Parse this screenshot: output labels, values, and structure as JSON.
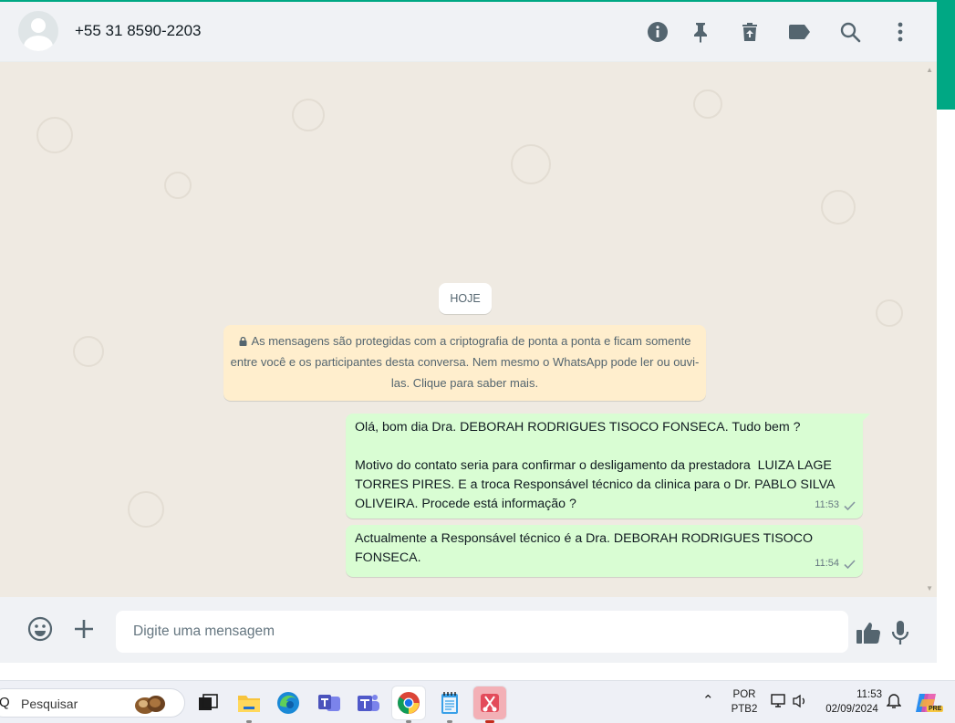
{
  "window": {
    "accent_color": "#00a884",
    "chat_bg": "#efeae2",
    "outgoing_bubble_color": "#d9fdd3"
  },
  "header": {
    "contact_name": "+55 31 8590-2203",
    "icons": [
      "info-icon",
      "pin-icon",
      "delete-icon",
      "label-icon",
      "search-icon",
      "menu-icon"
    ]
  },
  "chat": {
    "date_chip": "HOJE",
    "encryption_notice": "As mensagens são protegidas com a criptografia de ponta a ponta e ficam somente entre você e os participantes desta conversa. Nem mesmo o WhatsApp pode ler ou ouvi-las. Clique para saber mais.",
    "messages": [
      {
        "text": "Olá, bom dia Dra. DEBORAH RODRIGUES TISOCO FONSECA. Tudo bem ?\n\nMotivo do contato seria para confirmar o desligamento da prestadora  LUIZA LAGE TORRES PIRES. E a troca Responsável técnico da clinica para o Dr. PABLO SILVA OLIVEIRA. Procede está informação ?",
        "time": "11:53",
        "status": "sent"
      },
      {
        "text": "Actualmente a Responsável técnico é a Dra. DEBORAH RODRIGUES TISOCO FONSECA.",
        "time": "11:54",
        "status": "sent"
      }
    ]
  },
  "composer": {
    "placeholder": "Digite uma mensagem",
    "icons": [
      "emoji-icon",
      "plus-icon",
      "thumbs-up-icon",
      "microphone-icon"
    ]
  },
  "taskbar": {
    "search_label": "Pesquisar",
    "apps": [
      "task-view-icon",
      "file-explorer-icon",
      "edge-icon",
      "teams-icon",
      "teams-icon",
      "chrome-icon",
      "notepad-icon",
      "snipping-tool-icon"
    ],
    "language_top": "POR",
    "language_bottom": "PTB2",
    "time": "11:53",
    "date": "02/09/2024",
    "copilot_badge": "PRE"
  }
}
